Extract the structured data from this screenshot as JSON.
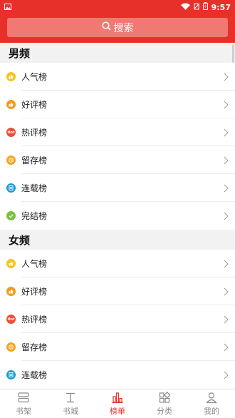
{
  "status_bar": {
    "time": "9:57"
  },
  "search": {
    "placeholder": "搜索"
  },
  "sections": [
    {
      "title": "男频",
      "items": [
        {
          "label": "人气榜",
          "icon": "thumbs-up-icon",
          "color": "#f5c518"
        },
        {
          "label": "好评榜",
          "icon": "good-review-icon",
          "color": "#f39a1e"
        },
        {
          "label": "热评榜",
          "icon": "hot-icon",
          "color": "#ef4b3a",
          "badge": "Hot"
        },
        {
          "label": "留存榜",
          "icon": "retention-icon",
          "color": "#f3a41e"
        },
        {
          "label": "连载榜",
          "icon": "serial-icon",
          "color": "#1a9ad7"
        },
        {
          "label": "完结榜",
          "icon": "check-icon",
          "color": "#7bc043"
        }
      ]
    },
    {
      "title": "女频",
      "items": [
        {
          "label": "人气榜",
          "icon": "thumbs-up-icon",
          "color": "#f5c518"
        },
        {
          "label": "好评榜",
          "icon": "good-review-icon",
          "color": "#f39a1e"
        },
        {
          "label": "热评榜",
          "icon": "hot-icon",
          "color": "#ef4b3a",
          "badge": "Hot"
        },
        {
          "label": "留存榜",
          "icon": "retention-icon",
          "color": "#f3a41e"
        },
        {
          "label": "连载榜",
          "icon": "serial-icon",
          "color": "#1a9ad7"
        }
      ]
    }
  ],
  "tabs": [
    {
      "label": "书架",
      "icon": "bookshelf-icon",
      "active": false
    },
    {
      "label": "书城",
      "icon": "bookstore-icon",
      "active": false
    },
    {
      "label": "榜单",
      "icon": "ranking-icon",
      "active": true
    },
    {
      "label": "分类",
      "icon": "category-icon",
      "active": false
    },
    {
      "label": "我的",
      "icon": "profile-icon",
      "active": false
    }
  ],
  "colors": {
    "accent": "#e8302a",
    "search_bg": "#f07a73",
    "section_bg": "#f2f2f2"
  }
}
